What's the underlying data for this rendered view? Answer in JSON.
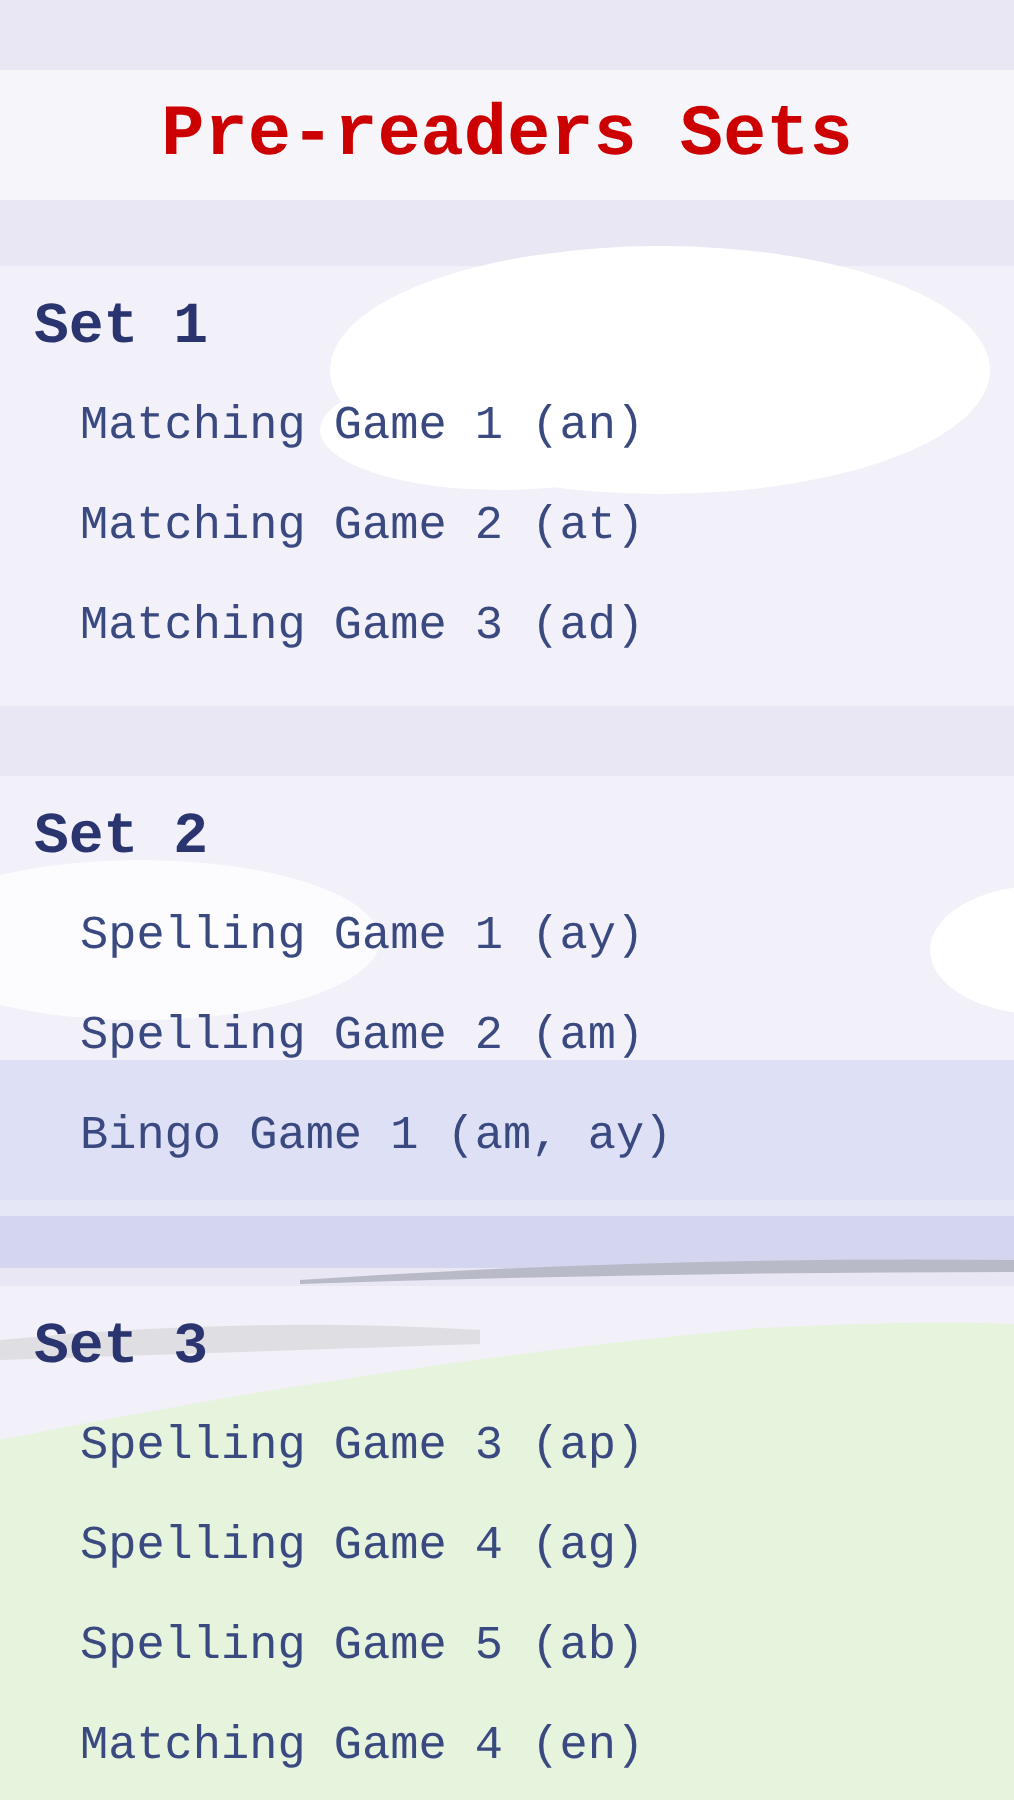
{
  "title": "Pre-readers Sets",
  "sets": [
    {
      "heading": "Set 1",
      "items": [
        "Matching Game 1 (an)",
        "Matching Game 2 (at)",
        "Matching Game 3 (ad)"
      ]
    },
    {
      "heading": "Set 2",
      "items": [
        "Spelling Game 1 (ay)",
        "Spelling Game 2 (am)",
        "Bingo Game 1 (am, ay)"
      ]
    },
    {
      "heading": "Set 3",
      "items": [
        "Spelling Game 3 (ap)",
        "Spelling Game 4 (ag)",
        "Spelling Game 5 (ab)",
        "Matching Game 4 (en)"
      ]
    }
  ]
}
